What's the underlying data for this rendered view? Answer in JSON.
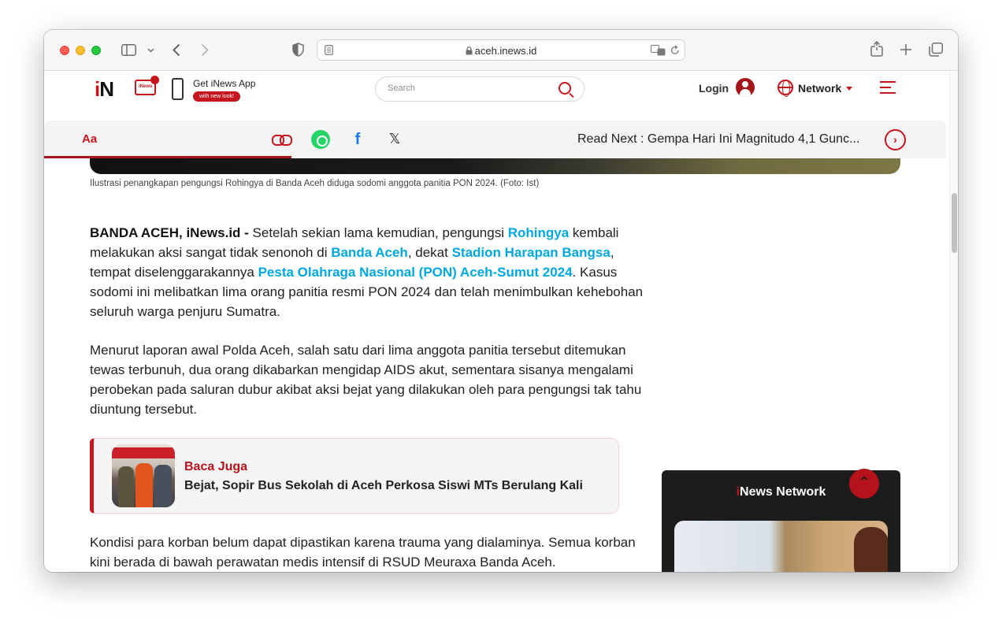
{
  "browser": {
    "url": "aceh.inews.id"
  },
  "header": {
    "logo_i": "i",
    "logo_n": "N",
    "tv_label": "iNews",
    "app_title": "Get iNews App",
    "app_pill": "with new look!",
    "search_placeholder": "Search",
    "login": "Login",
    "network": "Network"
  },
  "sharebar": {
    "font_size_label": "Aa",
    "fb": "f",
    "x": "𝕏",
    "read_next": "Read Next : Gempa Hari Ini Magnitudo 4,1 Gunc...",
    "read_next_icon": "›"
  },
  "article": {
    "caption": "Ilustrasi penangkapan pengungsi Rohingya di Banda Aceh diduga sodomi anggota panitia PON 2024. (Foto: Ist)",
    "p1": {
      "dateline": "BANDA ACEH, iNews.id -",
      "t1": " Setelah sekian lama kemudian, pengungsi ",
      "k1": "Rohingya",
      "t2": " kembali melakukan aksi sangat tidak senonoh di ",
      "k2": "Banda Aceh",
      "t3": ", dekat ",
      "k3": "Stadion Harapan Bangsa",
      "t4": ", tempat diselenggarakannya ",
      "k4": "Pesta Olahraga Nasional (PON) Aceh-Sumut 2024",
      "t5": ". Kasus sodomi ini melibatkan lima orang panitia resmi PON 2024 dan telah menimbulkan kehebohan seluruh warga penjuru Sumatra."
    },
    "p2": "Menurut laporan awal Polda Aceh, salah satu dari lima anggota panitia tersebut ditemukan tewas terbunuh, dua orang dikabarkan mengidap AIDS akut, sementara sisanya mengalami perobekan pada saluran dubur akibat aksi bejat yang dilakukan oleh para pengungsi tak tahu diuntung tersebut.",
    "p3": "Kondisi para korban belum dapat dipastikan karena trauma yang dialaminya. Semua korban kini berada di bawah perawatan medis intensif di RSUD Meuraxa Banda Aceh."
  },
  "baca_juga": {
    "label": "Baca Juga",
    "title": "Bejat, Sopir Bus Sekolah di Aceh Perkosa Siswi MTs Berulang Kali"
  },
  "network_box": {
    "title_i": "i",
    "title_rest": "News Network"
  },
  "scroll_top_icon": "⌃",
  "colors": {
    "brand_red": "#c4161c",
    "link_blue": "#00a7e1"
  }
}
